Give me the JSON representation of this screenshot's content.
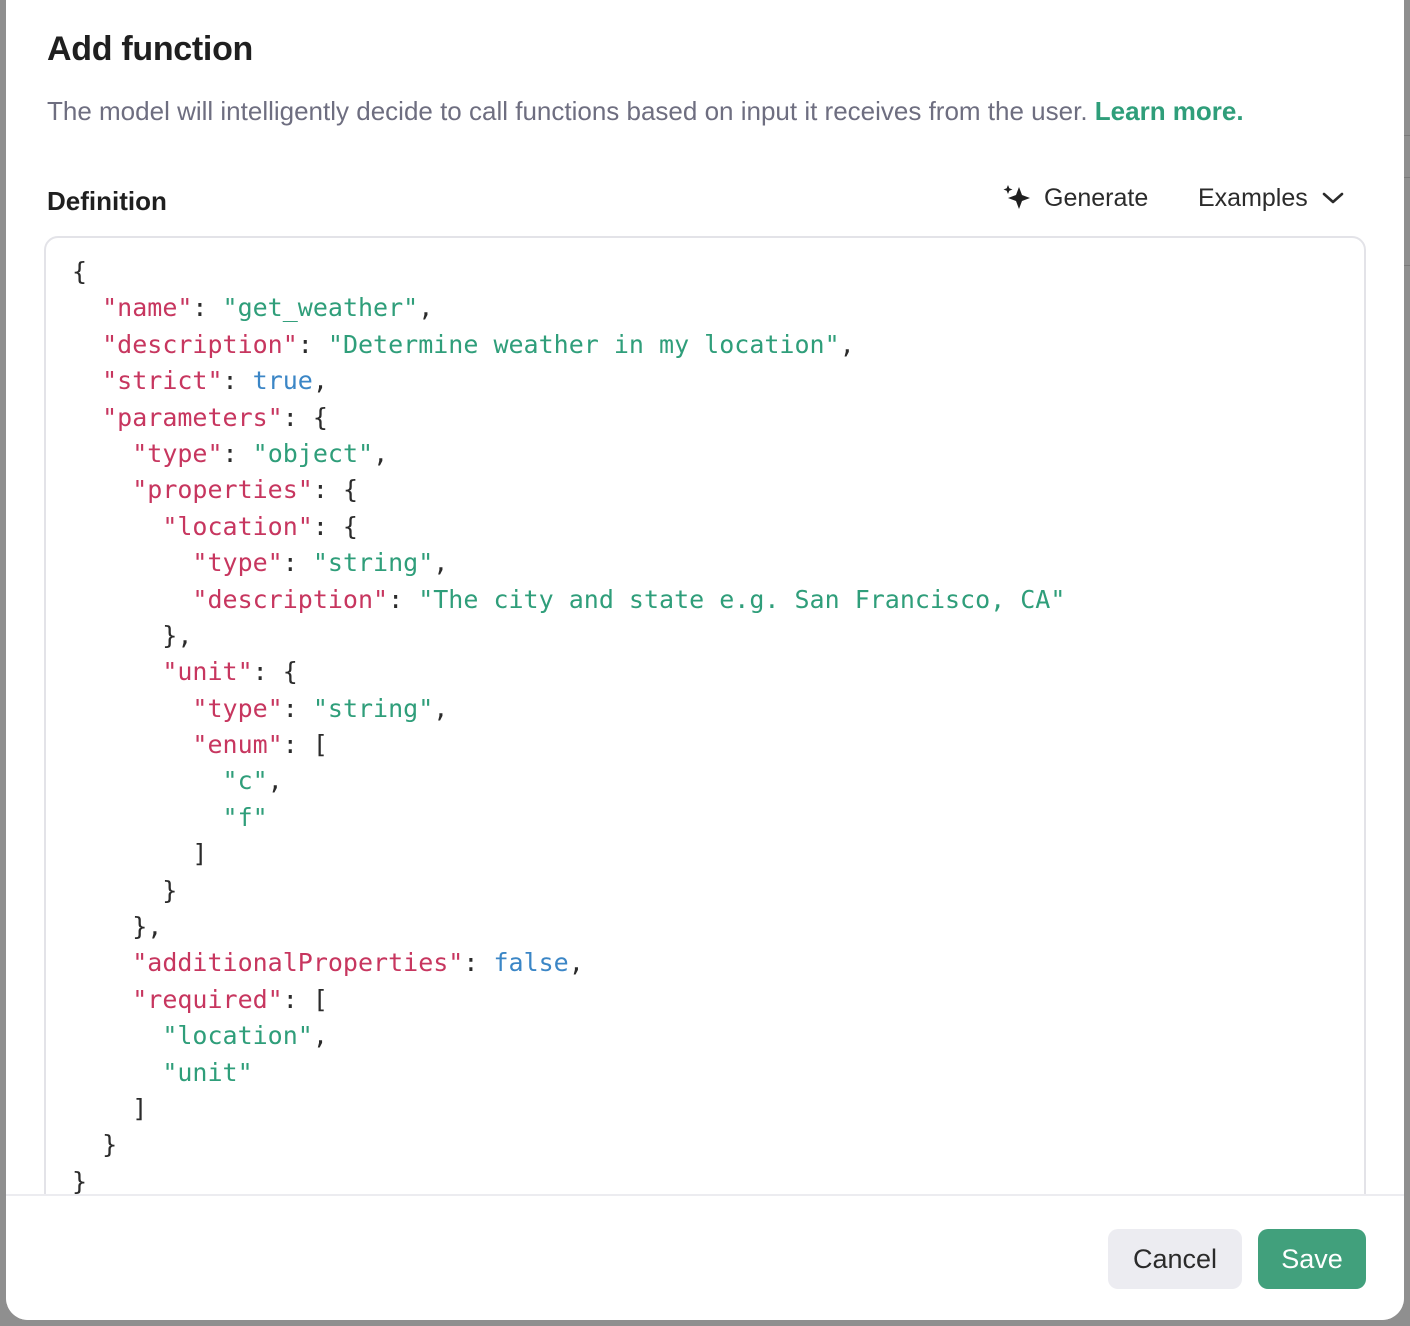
{
  "dialog": {
    "title": "Add function",
    "subtitle": "The model will intelligently decide to call functions based on input it receives from the user.",
    "learn_more_label": "Learn more."
  },
  "definition": {
    "label": "Definition",
    "generate_label": "Generate",
    "generate_icon": "sparkle-icon",
    "examples_label": "Examples",
    "examples_icon": "chevron-down-icon"
  },
  "editor": {
    "lines": [
      [
        {
          "t": "p",
          "v": "{"
        }
      ],
      [
        {
          "t": "p",
          "v": "  "
        },
        {
          "t": "k",
          "v": "\"name\""
        },
        {
          "t": "p",
          "v": ": "
        },
        {
          "t": "s",
          "v": "\"get_weather\""
        },
        {
          "t": "p",
          "v": ","
        }
      ],
      [
        {
          "t": "p",
          "v": "  "
        },
        {
          "t": "k",
          "v": "\"description\""
        },
        {
          "t": "p",
          "v": ": "
        },
        {
          "t": "s",
          "v": "\"Determine weather in my location\""
        },
        {
          "t": "p",
          "v": ","
        }
      ],
      [
        {
          "t": "p",
          "v": "  "
        },
        {
          "t": "k",
          "v": "\"strict\""
        },
        {
          "t": "p",
          "v": ": "
        },
        {
          "t": "b",
          "v": "true"
        },
        {
          "t": "p",
          "v": ","
        }
      ],
      [
        {
          "t": "p",
          "v": "  "
        },
        {
          "t": "k",
          "v": "\"parameters\""
        },
        {
          "t": "p",
          "v": ": {"
        }
      ],
      [
        {
          "t": "p",
          "v": "    "
        },
        {
          "t": "k",
          "v": "\"type\""
        },
        {
          "t": "p",
          "v": ": "
        },
        {
          "t": "s",
          "v": "\"object\""
        },
        {
          "t": "p",
          "v": ","
        }
      ],
      [
        {
          "t": "p",
          "v": "    "
        },
        {
          "t": "k",
          "v": "\"properties\""
        },
        {
          "t": "p",
          "v": ": {"
        }
      ],
      [
        {
          "t": "p",
          "v": "      "
        },
        {
          "t": "k",
          "v": "\"location\""
        },
        {
          "t": "p",
          "v": ": {"
        }
      ],
      [
        {
          "t": "p",
          "v": "        "
        },
        {
          "t": "k",
          "v": "\"type\""
        },
        {
          "t": "p",
          "v": ": "
        },
        {
          "t": "s",
          "v": "\"string\""
        },
        {
          "t": "p",
          "v": ","
        }
      ],
      [
        {
          "t": "p",
          "v": "        "
        },
        {
          "t": "k",
          "v": "\"description\""
        },
        {
          "t": "p",
          "v": ": "
        },
        {
          "t": "s",
          "v": "\"The city and state e.g. San Francisco, CA\""
        }
      ],
      [
        {
          "t": "p",
          "v": "      },"
        }
      ],
      [
        {
          "t": "p",
          "v": "      "
        },
        {
          "t": "k",
          "v": "\"unit\""
        },
        {
          "t": "p",
          "v": ": {"
        }
      ],
      [
        {
          "t": "p",
          "v": "        "
        },
        {
          "t": "k",
          "v": "\"type\""
        },
        {
          "t": "p",
          "v": ": "
        },
        {
          "t": "s",
          "v": "\"string\""
        },
        {
          "t": "p",
          "v": ","
        }
      ],
      [
        {
          "t": "p",
          "v": "        "
        },
        {
          "t": "k",
          "v": "\"enum\""
        },
        {
          "t": "p",
          "v": ": ["
        }
      ],
      [
        {
          "t": "p",
          "v": "          "
        },
        {
          "t": "s",
          "v": "\"c\""
        },
        {
          "t": "p",
          "v": ","
        }
      ],
      [
        {
          "t": "p",
          "v": "          "
        },
        {
          "t": "s",
          "v": "\"f\""
        }
      ],
      [
        {
          "t": "p",
          "v": "        ]"
        }
      ],
      [
        {
          "t": "p",
          "v": "      }"
        }
      ],
      [
        {
          "t": "p",
          "v": "    },"
        }
      ],
      [
        {
          "t": "p",
          "v": "    "
        },
        {
          "t": "k",
          "v": "\"additionalProperties\""
        },
        {
          "t": "p",
          "v": ": "
        },
        {
          "t": "b",
          "v": "false"
        },
        {
          "t": "p",
          "v": ","
        }
      ],
      [
        {
          "t": "p",
          "v": "    "
        },
        {
          "t": "k",
          "v": "\"required\""
        },
        {
          "t": "p",
          "v": ": ["
        }
      ],
      [
        {
          "t": "p",
          "v": "      "
        },
        {
          "t": "s",
          "v": "\"location\""
        },
        {
          "t": "p",
          "v": ","
        }
      ],
      [
        {
          "t": "p",
          "v": "      "
        },
        {
          "t": "s",
          "v": "\"unit\""
        }
      ],
      [
        {
          "t": "p",
          "v": "    ]"
        }
      ],
      [
        {
          "t": "p",
          "v": "  }"
        }
      ],
      [
        {
          "t": "p",
          "v": "}"
        }
      ]
    ]
  },
  "footer": {
    "cancel_label": "Cancel",
    "save_label": "Save"
  },
  "colors": {
    "accent": "#41a07c",
    "link": "#2f9e7a",
    "json_key": "#c7365f",
    "json_string": "#2f9e7a",
    "json_boolean": "#3b86c6"
  }
}
